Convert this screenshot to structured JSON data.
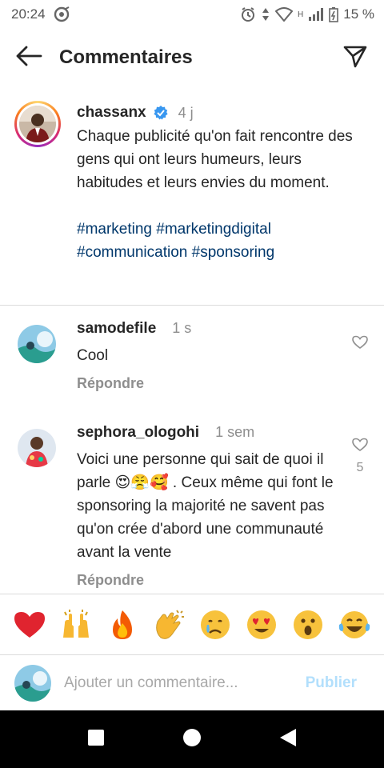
{
  "status_bar": {
    "time": "20:24",
    "network_label": "H",
    "battery_percent": "15 %"
  },
  "header": {
    "title": "Commentaires"
  },
  "caption": {
    "username": "chassanx",
    "time": "4 j",
    "text": "Chaque publicité qu'on fait rencontre des gens qui ont leurs humeurs, leurs habitudes et leurs envies du moment.",
    "hashtags": [
      "#marketing",
      "#marketingdigital",
      "#communication",
      "#sponsoring"
    ]
  },
  "comments": [
    {
      "username": "samodefile",
      "time": "1 s",
      "text": "Cool",
      "reply_label": "Répondre",
      "likes": ""
    },
    {
      "username": "sephora_ologohi",
      "time": "1 sem",
      "text_before": "Voici une personne qui sait de quoi il parle ",
      "text_emojis": "😍😤🥰",
      "text_after": " . Ceux même qui font le sponsoring la majorité ne savent pas qu'on crée d'abord une communauté avant la vente",
      "reply_label": "Répondre",
      "likes": "5"
    }
  ],
  "emoji_bar": [
    "❤️",
    "🙌",
    "🔥",
    "👏",
    "😢",
    "😍",
    "😮",
    "😂"
  ],
  "input": {
    "placeholder": "Ajouter un commentaire...",
    "value": "",
    "post_label": "Publier"
  },
  "colors": {
    "accent_link": "#00376b",
    "verified_blue": "#3897f0",
    "post_disabled": "#b2dffc",
    "muted": "#8e8e8e"
  },
  "icons": {
    "back": "arrow-left-icon",
    "send": "paper-plane-icon",
    "like": "heart-outline-icon",
    "verified": "verified-badge-icon"
  }
}
